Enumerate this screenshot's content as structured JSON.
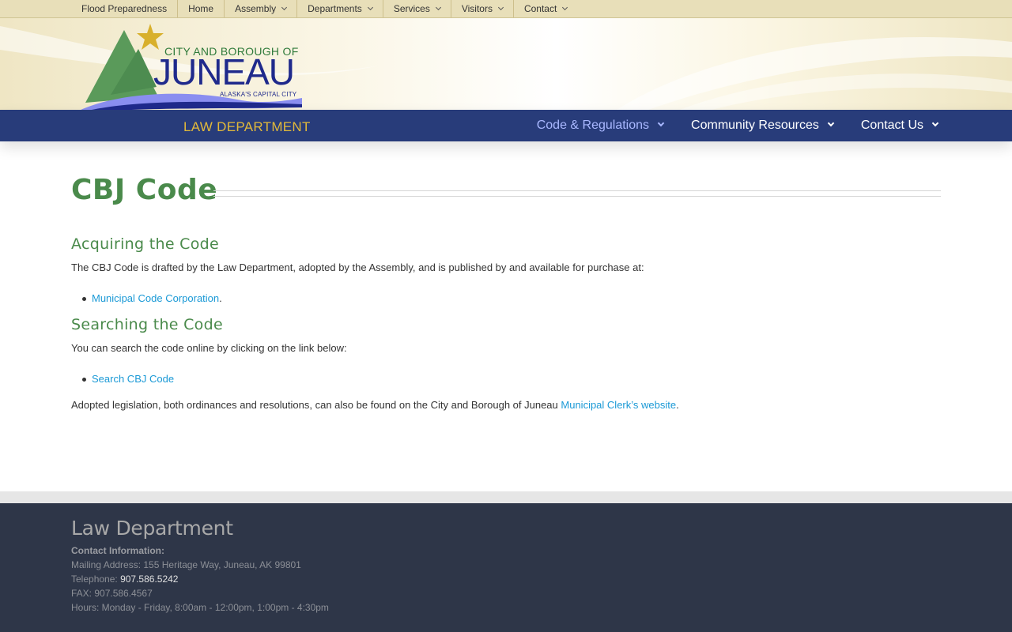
{
  "utility_nav": {
    "items": [
      {
        "label": "Flood Preparedness",
        "dropdown": false
      },
      {
        "label": "Home",
        "dropdown": false
      },
      {
        "label": "Assembly",
        "dropdown": true
      },
      {
        "label": "Departments",
        "dropdown": true
      },
      {
        "label": "Services",
        "dropdown": true
      },
      {
        "label": "Visitors",
        "dropdown": true
      },
      {
        "label": "Contact",
        "dropdown": true
      }
    ]
  },
  "logo": {
    "line1": "CITY AND BOROUGH OF",
    "line2": "JUNEAU",
    "tagline": "ALASKA'S CAPITAL CITY",
    "department": "LAW DEPARTMENT",
    "colors": {
      "mountain": "#5a9a5a",
      "star": "#d8b02c",
      "water": "#8a8ef0",
      "text": "#1f2a8c"
    }
  },
  "main_nav": {
    "items": [
      {
        "label": "Code & Regulations",
        "active": true
      },
      {
        "label": "Community Resources",
        "active": false
      },
      {
        "label": "Contact Us",
        "active": false
      }
    ]
  },
  "page": {
    "title": "CBJ Code",
    "sections": [
      {
        "heading": "Acquiring the Code",
        "intro": "The CBJ Code is drafted by the Law Department, adopted by the Assembly, and is published by and available for purchase at:",
        "link": "Municipal Code Corporation",
        "link_suffix": "."
      },
      {
        "heading": "Searching the Code",
        "intro": "You can search the code online by clicking on the link below:",
        "link": "Search CBJ Code",
        "link_suffix": ""
      }
    ],
    "closing": {
      "text": "Adopted legislation, both ordinances and resolutions, can also be found on the City and Borough of Juneau ",
      "link": "Municipal Clerk’s website",
      "suffix": "."
    }
  },
  "footer": {
    "title": "Law Department",
    "contact_heading": "Contact Information:",
    "mailing": "Mailing Address: 155 Heritage Way, Juneau, AK 99801",
    "telephone_label": "Telephone: ",
    "telephone": "907.586.5242",
    "fax": "FAX: 907.586.4567",
    "hours": "Hours: Monday - Friday, 8:00am - 12:00pm, 1:00pm - 4:30pm"
  },
  "colors": {
    "utility_bar": "#e8dfb9",
    "nav_bar": "#283c7a",
    "nav_active": "#a9b8ff",
    "heading_green": "#4a8a4b",
    "link_blue": "#1a99d6",
    "footer_bg": "#2e3648"
  }
}
